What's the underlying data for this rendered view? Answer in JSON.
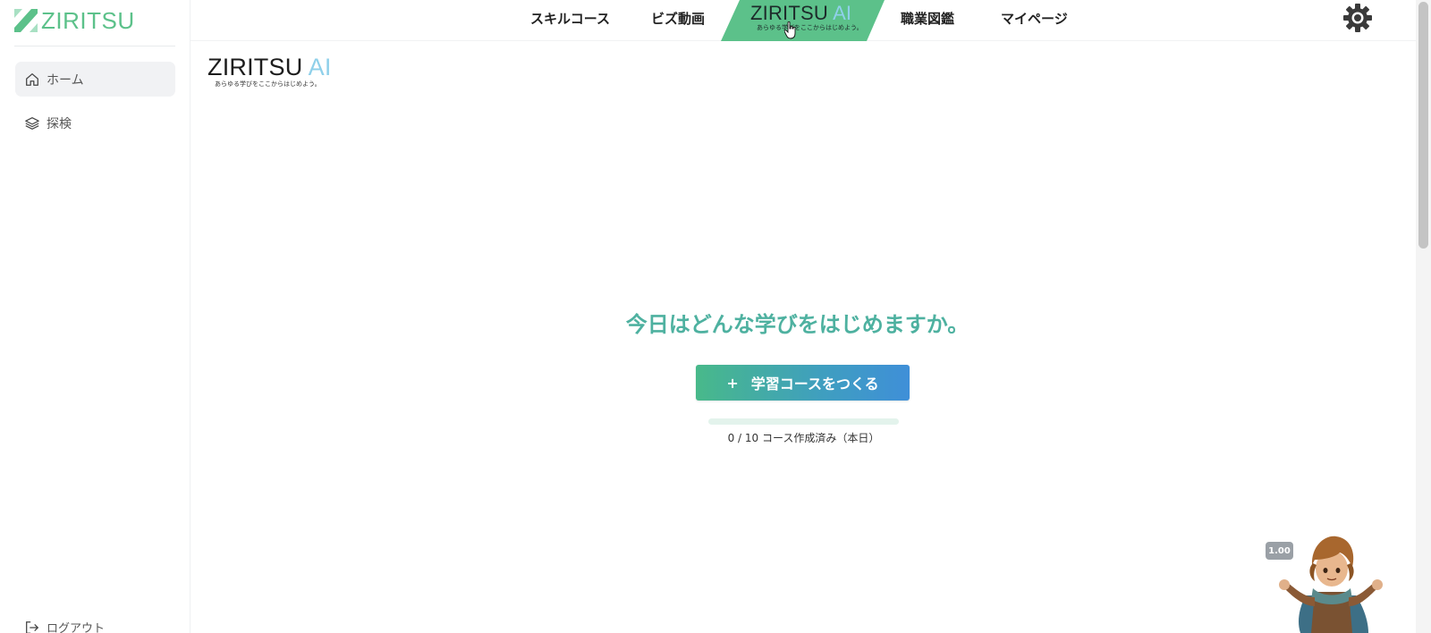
{
  "brand": {
    "name": "ZIRITSU",
    "color": "#5cc18a"
  },
  "sidebar": {
    "items": [
      {
        "label": "ホーム",
        "icon": "home-icon",
        "active": true
      },
      {
        "label": "探検",
        "icon": "layers-icon",
        "active": false
      }
    ],
    "logout_label": "ログアウト"
  },
  "topnav": {
    "tabs": [
      {
        "label": "スキルコース"
      },
      {
        "label": "ビズ動画"
      },
      {
        "label": "職業図鑑"
      },
      {
        "label": "マイページ"
      }
    ],
    "ai_tab": {
      "title_main": "ZIRITSU ",
      "title_suffix": "AI",
      "tagline": "あらゆる学びをここからはじめよう。",
      "active": true
    }
  },
  "content_logo": {
    "title_main": "ZIRITSU ",
    "title_suffix": "AI",
    "tagline": "あらゆる学びをここからはじめよう。"
  },
  "main": {
    "headline": "今日はどんな学びをはじめますか。",
    "create_button": {
      "plus": "+",
      "label": "学習コースをつくる"
    },
    "progress": {
      "created": 0,
      "limit": 10,
      "fraction": 0.0,
      "label": "0 / 10 コース作成済み（本日）"
    }
  },
  "mascot": {
    "zoom_label": "1.00"
  },
  "colors": {
    "accent_green": "#4cbf8f",
    "accent_blue": "#3f8fd8",
    "headline": "#4eb1a0",
    "ai_tab_bg": "#5cc18a"
  }
}
